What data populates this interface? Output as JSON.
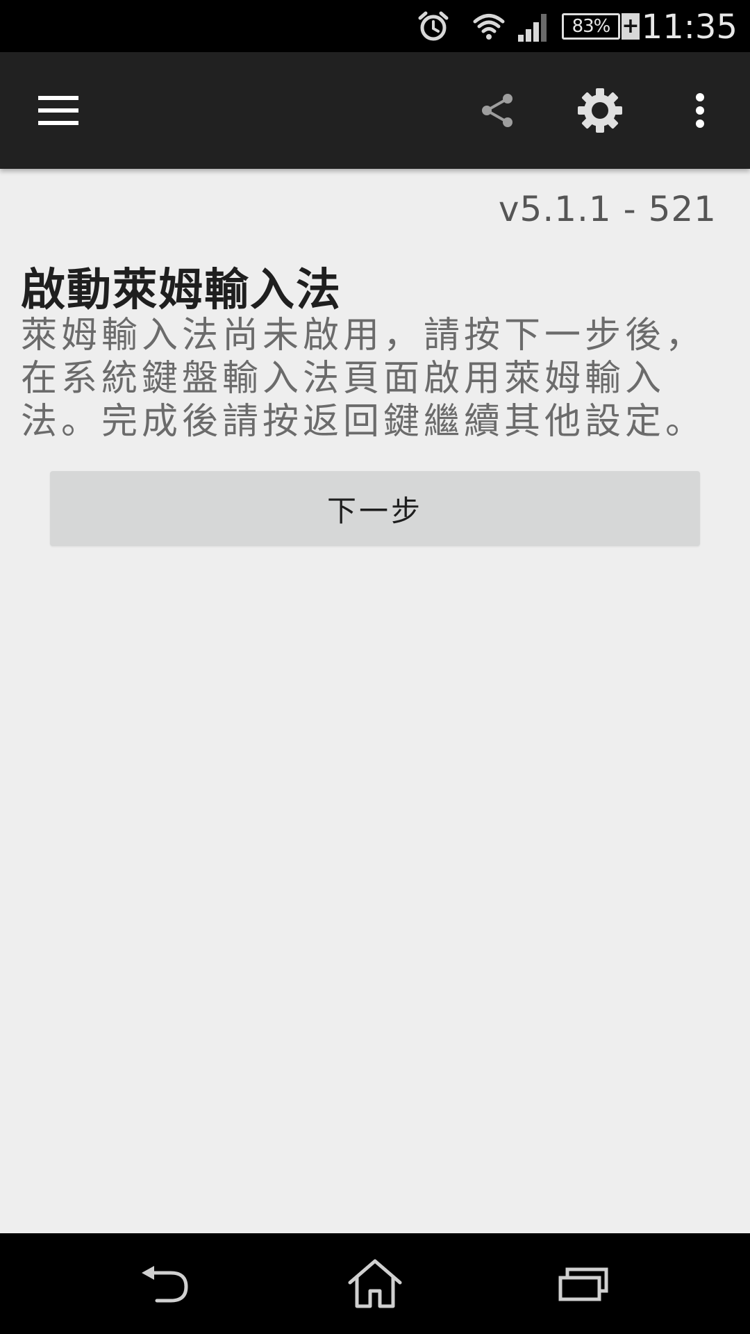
{
  "status_bar": {
    "time": "11:35",
    "battery_percent": "83%",
    "battery_charging_symbol": "+",
    "icons": [
      "alarm-icon",
      "wifi-icon",
      "signal-icon",
      "battery-icon"
    ]
  },
  "toolbar": {
    "icons": [
      "menu-icon",
      "share-icon",
      "settings-icon",
      "more-vert-icon"
    ]
  },
  "main": {
    "version": "v5.1.1 - 521",
    "title": "啟動萊姆輸入法",
    "description": "萊姆輸入法尚未啟用，請按下一步後，在系統鍵盤輸入法頁面啟用萊姆輸入法。完成後請按返回鍵繼續其他設定。",
    "next_button_label": "下一步"
  },
  "nav_bar": {
    "icons": [
      "back-icon",
      "home-icon",
      "recents-icon"
    ]
  },
  "colors": {
    "toolbar_bg": "#212121",
    "content_bg": "#eeeeee",
    "button_bg": "#d6d7d7"
  }
}
